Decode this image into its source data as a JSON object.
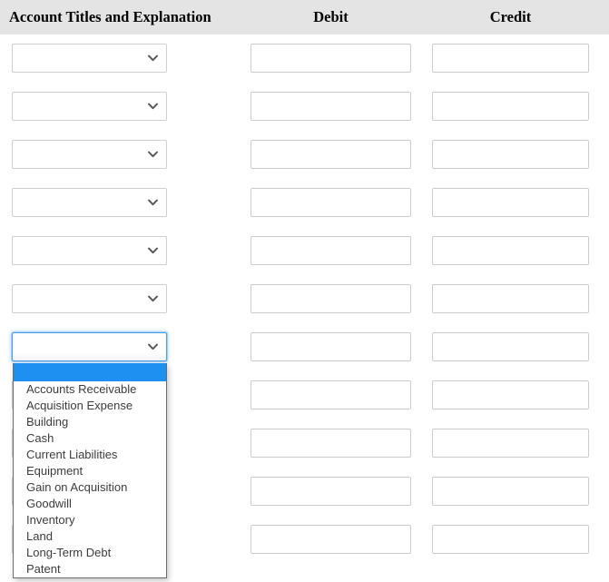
{
  "header": {
    "account_label": "Account Titles and Explanation",
    "debit_label": "Debit",
    "credit_label": "Credit",
    "background_color": "#e4e4e4"
  },
  "colors": {
    "highlight_blue": "#1e90f0",
    "focus_border": "#4a9eea",
    "input_border": "#cccccc",
    "panel_border": "#6b6b6b",
    "option_text": "#3c3c3c"
  },
  "table": {
    "row_count": 11,
    "rows": [
      {
        "account": "",
        "debit": "",
        "credit": ""
      },
      {
        "account": "",
        "debit": "",
        "credit": ""
      },
      {
        "account": "",
        "debit": "",
        "credit": ""
      },
      {
        "account": "",
        "debit": "",
        "credit": ""
      },
      {
        "account": "",
        "debit": "",
        "credit": ""
      },
      {
        "account": "",
        "debit": "",
        "credit": ""
      },
      {
        "account": "",
        "debit": "",
        "credit": ""
      },
      {
        "account": "",
        "debit": "",
        "credit": ""
      },
      {
        "account": "",
        "debit": "",
        "credit": ""
      },
      {
        "account": "",
        "debit": "",
        "credit": ""
      },
      {
        "account": "",
        "debit": "",
        "credit": ""
      }
    ]
  },
  "dropdown": {
    "open": true,
    "open_row_index": 7,
    "selected_value": "",
    "selected_index": 0,
    "options": [
      "",
      "Accounts Receivable",
      "Acquisition Expense",
      "Building",
      "Cash",
      "Current Liabilities",
      "Equipment",
      "Gain on Acquisition",
      "Goodwill",
      "Inventory",
      "Land",
      "Long-Term Debt",
      "Patent"
    ]
  },
  "icons": {
    "chevron_down": "chevron-down-icon"
  }
}
